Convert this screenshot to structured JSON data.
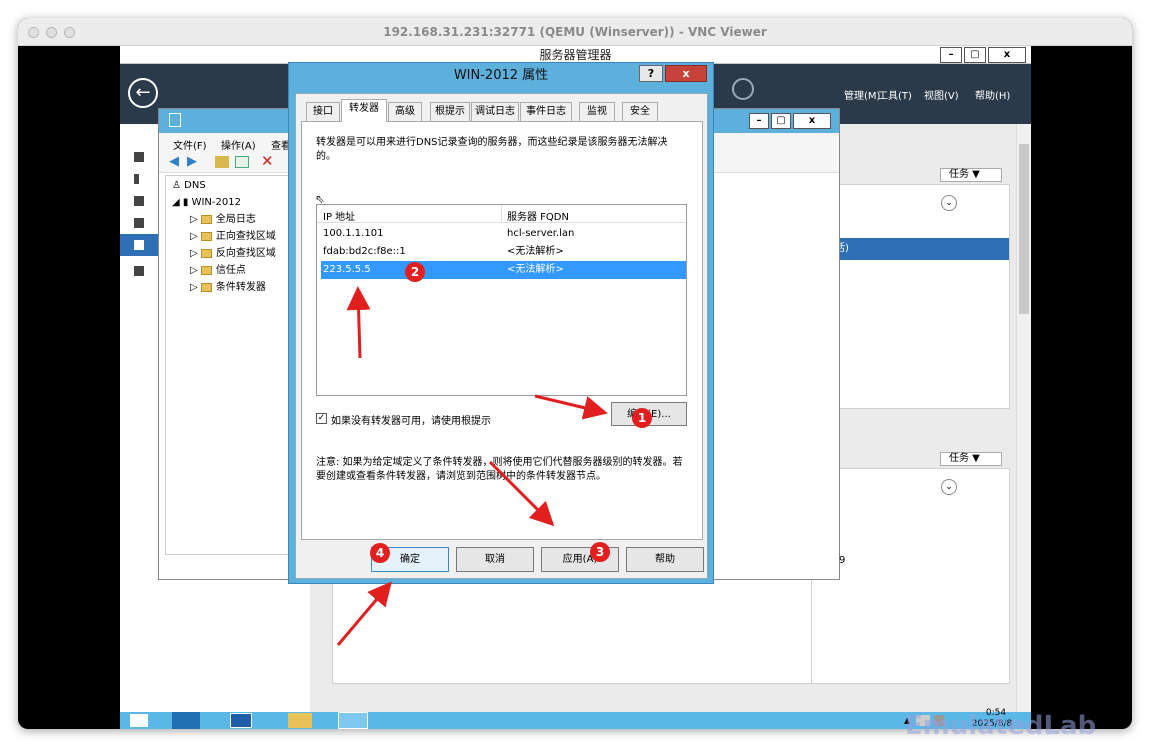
{
  "vnc": {
    "title": "192.168.31.231:32771 (QEMU (Winserver)) - VNC Viewer"
  },
  "server_manager": {
    "title": "服务器管理器",
    "menu": [
      "管理(M)",
      "工具(T)",
      "视图(V)",
      "帮助(H)"
    ],
    "tasks_label": "任务",
    "activated_text": "已激活)"
  },
  "dns_manager": {
    "menu": [
      "文件(F)",
      "操作(A)",
      "查看"
    ],
    "tree": [
      {
        "label": "DNS",
        "level": 0
      },
      {
        "label": "WIN-2012",
        "level": 1
      },
      {
        "label": "全局日志",
        "level": 2
      },
      {
        "label": "正向查找区域",
        "level": 2
      },
      {
        "label": "反向查找区域",
        "level": 2
      },
      {
        "label": "信任点",
        "level": 2
      },
      {
        "label": "条件转发器",
        "level": 2
      }
    ],
    "status_num": "9"
  },
  "dialog": {
    "title": "WIN-2012 属性",
    "tabs": [
      "接口",
      "转发器",
      "高级",
      "根提示",
      "调试日志",
      "事件日志",
      "监视",
      "安全"
    ],
    "active_tab": "转发器",
    "description": "转发器是可以用来进行DNS记录查询的服务器，而这些纪录是该服务器无法解决的。",
    "columns": [
      "IP 地址",
      "服务器 FQDN"
    ],
    "rows": [
      {
        "ip": "100.1.1.101",
        "fqdn": "hcl-server.lan"
      },
      {
        "ip": "fdab:bd2c:f8e::1",
        "fqdn": "<无法解析>"
      },
      {
        "ip": "223.5.5.5",
        "fqdn": "<无法解析>"
      }
    ],
    "selected_row": 2,
    "checkbox_label": "如果没有转发器可用，请使用根提示",
    "checkbox_checked": true,
    "edit_button": "编辑(E)...",
    "note": "注意: 如果为给定域定义了条件转发器，则将使用它们代替服务器级别的转发器。若要创建或查看条件转发器，请浏览到范围树中的条件转发器节点。",
    "buttons": {
      "ok": "确定",
      "cancel": "取消",
      "apply": "应用(A)",
      "help": "帮助"
    },
    "help_glyph": "?",
    "close_glyph": "x"
  },
  "annotations": [
    "1",
    "2",
    "3",
    "4"
  ],
  "annotation_color": "#e21f1f",
  "taskbar": {
    "time": "0:54",
    "date": "2025/8/8"
  },
  "watermark": "EmulatedLab"
}
